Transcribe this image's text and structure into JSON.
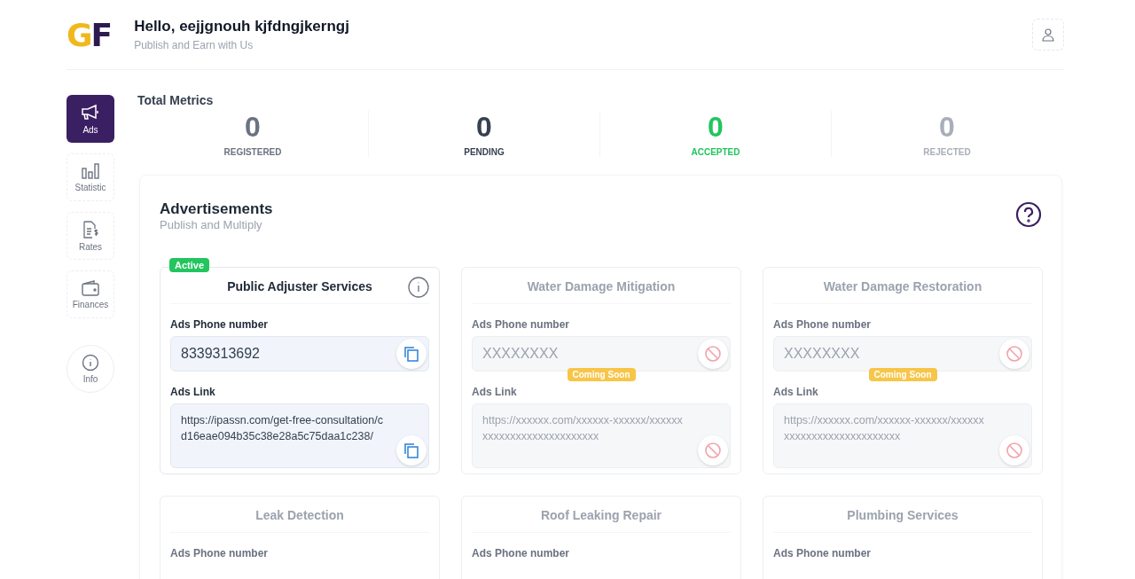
{
  "header": {
    "logo": [
      "G",
      "F"
    ],
    "greeting": "Hello, eejjgnouh kjfdngjkerngj",
    "subtitle": "Publish and Earn with Us"
  },
  "sidebar": {
    "items": [
      {
        "label": "Ads",
        "kind": "megaphone",
        "selected": true
      },
      {
        "label": "Statistic",
        "kind": "chart",
        "selected": false
      },
      {
        "label": "Rates",
        "kind": "rates",
        "selected": false
      },
      {
        "label": "Finances",
        "kind": "wallet",
        "selected": false
      }
    ],
    "info": {
      "label": "Info"
    }
  },
  "metrics": {
    "title": "Total Metrics",
    "items": [
      {
        "value": "0",
        "label": "REGISTERED",
        "color": "#6b7280"
      },
      {
        "value": "0",
        "label": "PENDING",
        "color": "#374151"
      },
      {
        "value": "0",
        "label": "ACCEPTED",
        "color": "#22c55e"
      },
      {
        "value": "0",
        "label": "REJECTED",
        "color": "#a9afb8"
      }
    ]
  },
  "advertisements": {
    "title": "Advertisements",
    "subtitle": "Publish and Multiply",
    "cards": [
      {
        "title": "Public Adjuster Services",
        "active": true,
        "badge": "Active",
        "phone_label": "Ads Phone number",
        "phone": "8339313692",
        "link_label": "Ads Link",
        "link": "https://ipassn.com/get-free-consultation/cd16eae094b35c38e28a5c75daa1c238/"
      },
      {
        "title": "Water Damage Mitigation",
        "active": false,
        "badge": "Coming Soon",
        "phone_label": "Ads Phone number",
        "phone": "XXXXXXXX",
        "link_label": "Ads Link",
        "link": "https://xxxxxx.com/xxxxxx-xxxxxx/xxxxxxxxxxxxxxxxxxxxxxxxxxx"
      },
      {
        "title": "Water Damage Restoration",
        "active": false,
        "badge": "Coming Soon",
        "phone_label": "Ads Phone number",
        "phone": "XXXXXXXX",
        "link_label": "Ads Link",
        "link": "https://xxxxxx.com/xxxxxx-xxxxxx/xxxxxxxxxxxxxxxxxxxxxxxxxxx"
      },
      {
        "title": "Leak Detection",
        "active": false,
        "phone_label": "Ads Phone number"
      },
      {
        "title": "Roof Leaking Repair",
        "active": false,
        "phone_label": "Ads Phone number"
      },
      {
        "title": "Plumbing Services",
        "active": false,
        "phone_label": "Ads Phone number"
      }
    ]
  }
}
